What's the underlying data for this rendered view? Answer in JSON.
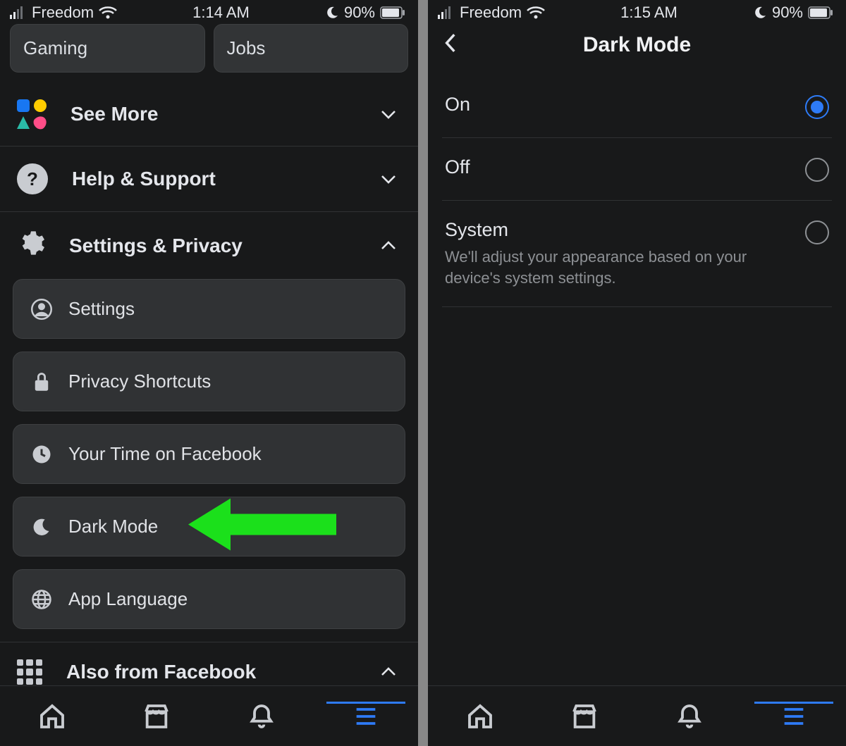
{
  "screen1": {
    "status": {
      "carrier": "Freedom",
      "time": "1:14 AM",
      "battery": "90%"
    },
    "cards": [
      "Gaming",
      "Jobs"
    ],
    "see_more": "See More",
    "help_support": "Help & Support",
    "settings_privacy": "Settings & Privacy",
    "subitems": {
      "settings": "Settings",
      "privacy_shortcuts": "Privacy Shortcuts",
      "your_time": "Your Time on Facebook",
      "dark_mode": "Dark Mode",
      "app_language": "App Language"
    },
    "also_from": "Also from Facebook"
  },
  "screen2": {
    "status": {
      "carrier": "Freedom",
      "time": "1:15 AM",
      "battery": "90%"
    },
    "title": "Dark Mode",
    "options": {
      "on": "On",
      "off": "Off",
      "system": "System",
      "system_desc": "We'll adjust your appearance based on your device's system settings."
    },
    "selected": "on"
  }
}
